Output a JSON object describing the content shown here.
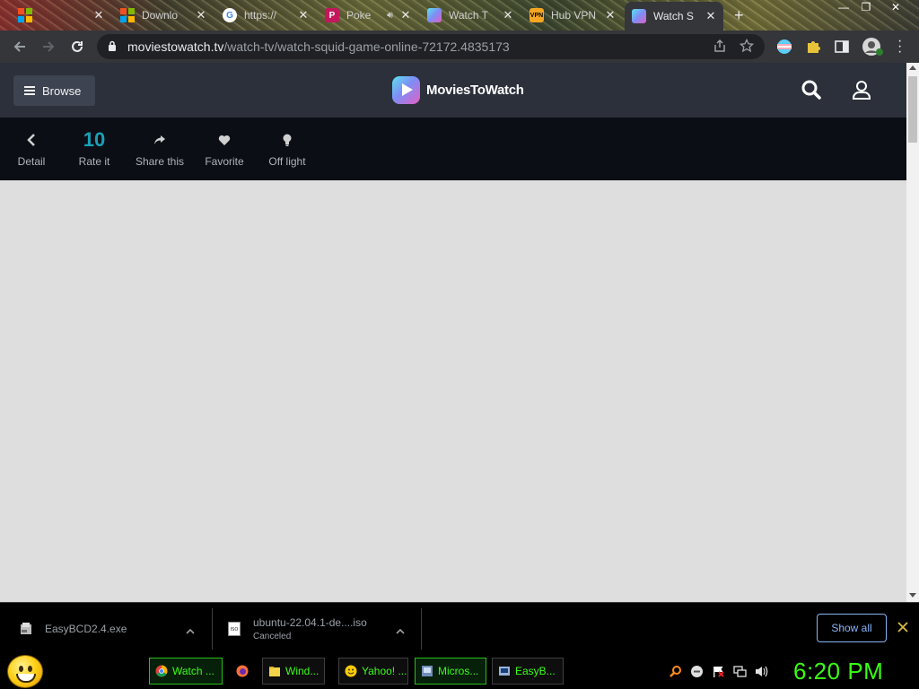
{
  "browser": {
    "tabs": [
      {
        "title": "",
        "favicon": "windows-icon",
        "color": "#00a4ef"
      },
      {
        "title": "Downlo",
        "favicon": "windows-icon",
        "color": "#f25022"
      },
      {
        "title": "https://",
        "favicon": "google-icon",
        "color": "#ffffff"
      },
      {
        "title": "Poke",
        "favicon": "p-icon",
        "color": "#c2185b"
      },
      {
        "title": "Watch T",
        "favicon": "moviestowatch-icon",
        "color": "#7d8df5"
      },
      {
        "title": "Hub VPN",
        "favicon": "vpn-hub-icon",
        "color": "#f5a623"
      },
      {
        "title": "Watch S",
        "favicon": "moviestowatch-icon",
        "color": "#7d8df5",
        "active": true
      }
    ],
    "new_tab": "+",
    "url_host": "moviestowatch.tv",
    "url_path": "/watch-tv/watch-squid-game-online-72172.4835173"
  },
  "site": {
    "browse_label": "Browse",
    "logo_text": "MoviesToWatch",
    "actions": [
      {
        "label": "Detail",
        "icon": "chevron-left-icon"
      },
      {
        "label": "Rate it",
        "value": "10",
        "icon": "rating-icon"
      },
      {
        "label": "Share this",
        "icon": "share-icon"
      },
      {
        "label": "Favorite",
        "icon": "heart-icon"
      },
      {
        "label": "Off light",
        "icon": "lightbulb-icon"
      }
    ]
  },
  "downloads": {
    "items": [
      {
        "name": "EasyBCD2.4.exe",
        "status": ""
      },
      {
        "name": "ubuntu-22.04.1-de....iso",
        "status": "Canceled"
      }
    ],
    "show_all_label": "Show all"
  },
  "taskbar": {
    "buttons": [
      {
        "label": "Watch ...",
        "icon": "chrome-icon",
        "active": true
      },
      {
        "label": "",
        "icon": "firefox-icon"
      },
      {
        "label": "Wind...",
        "icon": "folder-icon"
      },
      {
        "label": "Yahoo! ...",
        "icon": "yahoo-smiley-icon"
      },
      {
        "label": "Micros...",
        "icon": "microsoft-icon",
        "active": true
      },
      {
        "label": "EasyB...",
        "icon": "easybcd-icon"
      }
    ],
    "clock": "6:20 PM"
  },
  "colors": {
    "site_header": "#2b303a",
    "action_bar": "#0b0f15",
    "rating_accent": "#1aa0b7",
    "taskbar_text": "#39ff14",
    "show_all_border": "#8ab4f8"
  }
}
